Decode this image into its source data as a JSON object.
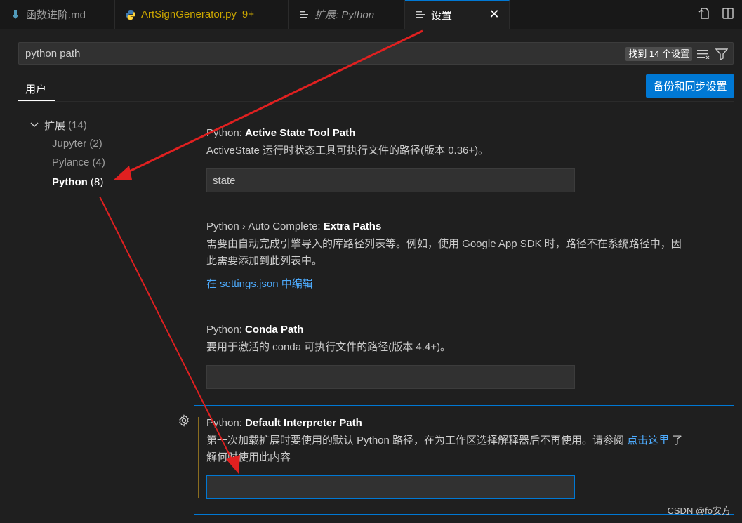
{
  "tabs": [
    {
      "label": "函数进阶.md",
      "icon": "download-icon",
      "active": false,
      "badge": ""
    },
    {
      "label": "ArtSignGenerator.py",
      "icon": "python-icon",
      "active": false,
      "badge": "9+"
    },
    {
      "label": "扩展: Python",
      "icon": "preview-icon",
      "active": false,
      "badge": ""
    },
    {
      "label": "设置",
      "icon": "settings-file-icon",
      "active": true,
      "badge": "",
      "close": "✕"
    }
  ],
  "search": {
    "value": "python path",
    "result_count": "找到 14 个设置"
  },
  "scope": {
    "user_tab": "用户",
    "sync_button": "备份和同步设置"
  },
  "toc": {
    "group_label": "扩展",
    "group_count": "(14)",
    "items": [
      {
        "name": "Jupyter",
        "count": "(2)"
      },
      {
        "name": "Pylance",
        "count": "(4)"
      },
      {
        "name": "Python",
        "count": "(8)"
      }
    ]
  },
  "settings": [
    {
      "prefix": "Python: ",
      "name": "Active State Tool Path",
      "description": "ActiveState 运行时状态工具可执行文件的路径(版本 0.36+)。",
      "value": "state"
    },
    {
      "prefix": "Python › Auto Complete: ",
      "name": "Extra Paths",
      "description_line1": "需要由自动完成引擎导入的库路径列表等。例如，使用 Google App SDK 时，路径不在系统路径中，因",
      "description_line2": "此需要添加到此列表中。",
      "link": "在 settings.json 中编辑"
    },
    {
      "prefix": "Python: ",
      "name": "Conda Path",
      "description": "要用于激活的 conda 可执行文件的路径(版本 4.4+)。",
      "value": ""
    },
    {
      "prefix": "Python: ",
      "name": "Default Interpreter Path",
      "description_part1": "第一次加载扩展时要使用的默认 Python 路径，在为工作区选择解释器后不再使用。请参阅 ",
      "link": "点击这里",
      "description_part2": " 了",
      "description_line2": "解何时使用此内容",
      "value": ""
    }
  ],
  "watermark": "CSDN @fo安方",
  "colors": {
    "accent": "#0078d4",
    "annotation_arrow": "#e02020",
    "link": "#4daafc",
    "warning": "#cca700"
  }
}
